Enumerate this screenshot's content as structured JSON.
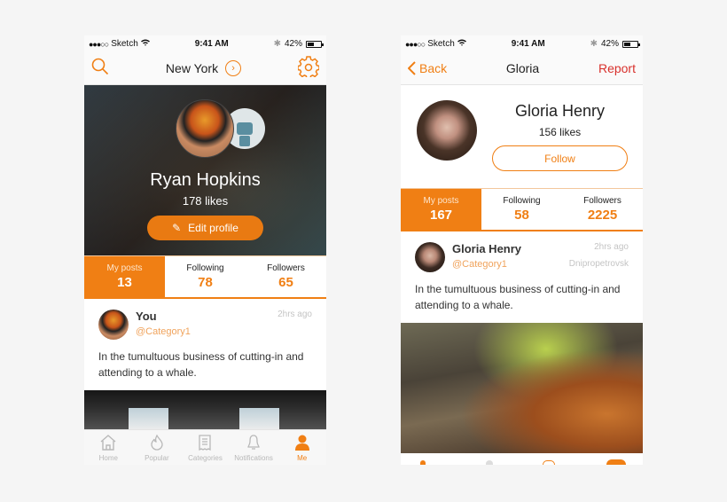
{
  "colors": {
    "accent": "#f07f14",
    "report": "#d8312c"
  },
  "left_screen": {
    "status": {
      "carrier": "Sketch",
      "time": "9:41 AM",
      "battery": "42%"
    },
    "nav": {
      "title": "New York"
    },
    "profile": {
      "name": "Ryan Hopkins",
      "likes": "178 likes",
      "edit_label": "Edit profile"
    },
    "stats": [
      {
        "label": "My posts",
        "value": "13"
      },
      {
        "label": "Following",
        "value": "78"
      },
      {
        "label": "Followers",
        "value": "65"
      }
    ],
    "post": {
      "author": "You",
      "category": "@Category1",
      "time": "2hrs ago",
      "text": "In the tumultuous business of cutting-in and attending to a whale."
    },
    "tabs": [
      {
        "label": "Home",
        "icon": "home-icon"
      },
      {
        "label": "Popular",
        "icon": "flame-icon"
      },
      {
        "label": "Categories",
        "icon": "list-icon"
      },
      {
        "label": "Notifications",
        "icon": "bell-icon"
      },
      {
        "label": "Me",
        "icon": "person-icon"
      }
    ]
  },
  "right_screen": {
    "status": {
      "carrier": "Sketch",
      "time": "9:41 AM",
      "battery": "42%"
    },
    "nav": {
      "back_label": "Back",
      "title": "Gloria",
      "report_label": "Report"
    },
    "profile": {
      "name": "Gloria Henry",
      "likes": "156 likes",
      "follow_label": "Follow"
    },
    "stats": [
      {
        "label": "My posts",
        "value": "167"
      },
      {
        "label": "Following",
        "value": "58"
      },
      {
        "label": "Followers",
        "value": "2225"
      }
    ],
    "post": {
      "author": "Gloria Henry",
      "category": "@Category1",
      "time": "2hrs ago",
      "location": "Dnipropetrovsk",
      "text": "In the tumultuous business of cutting-in and attending to a whale."
    }
  }
}
